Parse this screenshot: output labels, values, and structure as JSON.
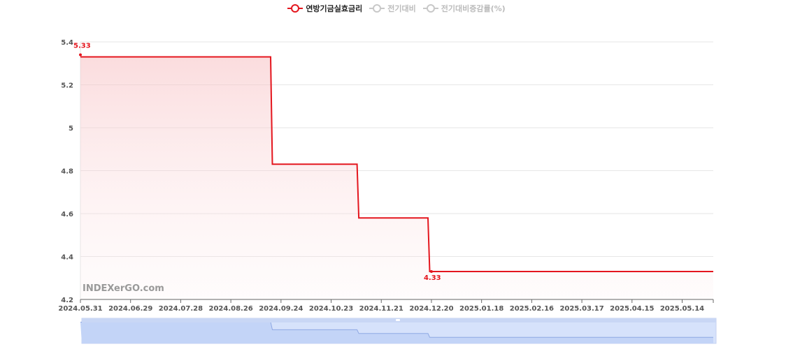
{
  "chart_data": {
    "type": "line",
    "step": true,
    "watermark": "INDEXerGO.com",
    "x_ticks": [
      "2024.05.31",
      "2024.06.29",
      "2024.07.28",
      "2024.08.26",
      "2024.09.24",
      "2024.10.23",
      "2024.11.21",
      "2024.12.20",
      "2025.01.18",
      "2025.02.16",
      "2025.03.17",
      "2025.04.15",
      "2025.05.14"
    ],
    "x_range": [
      "2024.05.31",
      "2025.06.01"
    ],
    "ylim": [
      4.2,
      5.4
    ],
    "y_ticks": [
      4.2,
      4.4,
      4.6,
      4.8,
      5,
      5.2,
      5.4
    ],
    "grid": true,
    "legend_position": "top-center",
    "series": [
      {
        "name": "연방기금실효금리",
        "color": "#e4161e",
        "active": true,
        "area_fill": true,
        "points": [
          {
            "x": "2024.05.31",
            "y": 5.33
          },
          {
            "x": "2024.09.18",
            "y": 5.33
          },
          {
            "x": "2024.09.19",
            "y": 4.83
          },
          {
            "x": "2024.11.07",
            "y": 4.83
          },
          {
            "x": "2024.11.08",
            "y": 4.58
          },
          {
            "x": "2024.12.18",
            "y": 4.58
          },
          {
            "x": "2024.12.19",
            "y": 4.33
          },
          {
            "x": "2025.06.01",
            "y": 4.33
          }
        ],
        "labels": [
          {
            "x": "2024.05.31",
            "y": 5.33,
            "text": "5.33"
          },
          {
            "x": "2024.12.20",
            "y": 4.33,
            "text": "4.33"
          }
        ]
      },
      {
        "name": "전기대비",
        "color": "#bbbbbb",
        "active": false
      },
      {
        "name": "전기대비증감률(%)",
        "color": "#bbbbbb",
        "active": false
      }
    ]
  }
}
